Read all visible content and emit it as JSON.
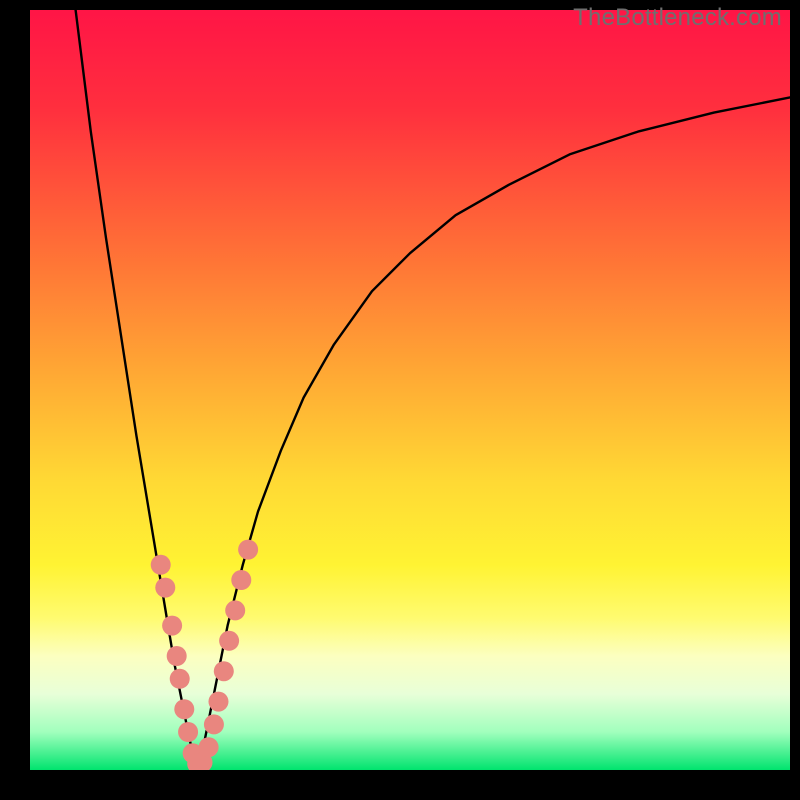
{
  "watermark": "TheBottleneck.com",
  "frame": {
    "outer_size": 800,
    "margin_left": 30,
    "margin_right": 10,
    "margin_top": 10,
    "margin_bottom": 30
  },
  "gradient": {
    "stops": [
      {
        "offset": 0.0,
        "color": "#ff1546"
      },
      {
        "offset": 0.13,
        "color": "#ff2f3e"
      },
      {
        "offset": 0.3,
        "color": "#ff6a37"
      },
      {
        "offset": 0.48,
        "color": "#ffa934"
      },
      {
        "offset": 0.62,
        "color": "#ffd934"
      },
      {
        "offset": 0.73,
        "color": "#fff333"
      },
      {
        "offset": 0.8,
        "color": "#fffb70"
      },
      {
        "offset": 0.85,
        "color": "#fcffc0"
      },
      {
        "offset": 0.9,
        "color": "#e8ffd8"
      },
      {
        "offset": 0.95,
        "color": "#a1ffbd"
      },
      {
        "offset": 1.0,
        "color": "#00e46e"
      }
    ]
  },
  "chart_data": {
    "type": "line",
    "title": "",
    "xlabel": "",
    "ylabel": "",
    "xlim": [
      0,
      100
    ],
    "ylim": [
      0,
      100
    ],
    "x_minimum": 22,
    "series": [
      {
        "name": "left-branch",
        "x": [
          6,
          8,
          10,
          12,
          14,
          15,
          16,
          17,
          18,
          19,
          20,
          21,
          22
        ],
        "y": [
          100,
          84,
          70,
          57,
          44,
          38,
          32,
          26,
          20,
          14,
          9,
          4,
          0
        ]
      },
      {
        "name": "right-branch",
        "x": [
          22,
          23,
          24,
          25,
          26,
          28,
          30,
          33,
          36,
          40,
          45,
          50,
          56,
          63,
          71,
          80,
          90,
          100
        ],
        "y": [
          0,
          4,
          9,
          14,
          19,
          27,
          34,
          42,
          49,
          56,
          63,
          68,
          73,
          77,
          81,
          84,
          86.5,
          88.5
        ]
      }
    ],
    "markers": {
      "name": "highlight-dots",
      "color": "#e9867f",
      "radius_px": 10,
      "points": [
        {
          "x": 17.2,
          "y": 27
        },
        {
          "x": 17.8,
          "y": 24
        },
        {
          "x": 18.7,
          "y": 19
        },
        {
          "x": 19.3,
          "y": 15
        },
        {
          "x": 19.7,
          "y": 12
        },
        {
          "x": 20.3,
          "y": 8
        },
        {
          "x": 20.8,
          "y": 5
        },
        {
          "x": 21.4,
          "y": 2.2
        },
        {
          "x": 22.0,
          "y": 0.8
        },
        {
          "x": 22.7,
          "y": 1.0
        },
        {
          "x": 23.5,
          "y": 3.0
        },
        {
          "x": 24.2,
          "y": 6.0
        },
        {
          "x": 24.8,
          "y": 9.0
        },
        {
          "x": 25.5,
          "y": 13.0
        },
        {
          "x": 26.2,
          "y": 17.0
        },
        {
          "x": 27.0,
          "y": 21.0
        },
        {
          "x": 27.8,
          "y": 25.0
        },
        {
          "x": 28.7,
          "y": 29.0
        }
      ]
    }
  }
}
